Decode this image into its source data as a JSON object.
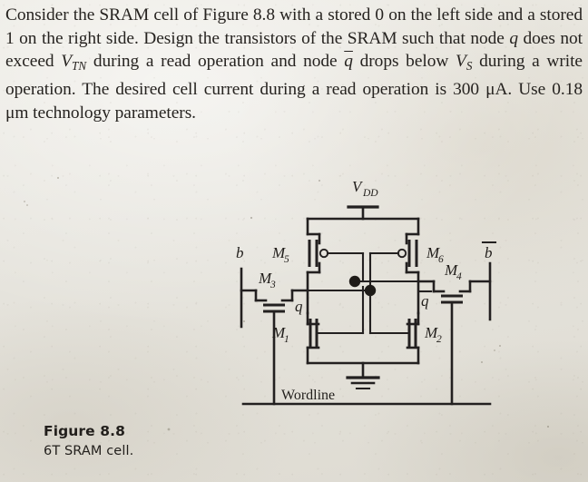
{
  "page": {
    "background_color": "#e6e4de",
    "ink_color": "#232020"
  },
  "statement": {
    "line1_a": "Consider the SRAM cell of Figure 8.8 with a stored 0 on the left side and a stored 1 on the right side. Design the transistors of the SRAM such that node ",
    "q_italic": "q",
    "line1_b": " does not exceed ",
    "v_tn": "V",
    "v_tn_sub": "TN",
    "line1_c": " during a read operation and node ",
    "qbar_italic": "q",
    "line1_d": " drops below ",
    "v_s": "V",
    "v_s_sub": "S",
    "line1_e": " during a write operation. The desired cell current during a read operation is 300 μA. Use 0.18 μm technology parameters."
  },
  "caption": {
    "title": "Figure 8.8",
    "subtitle": "6T SRAM cell."
  },
  "circuit": {
    "type": "6T SRAM cell schematic",
    "supply_label": "V",
    "supply_sublabel": "DD",
    "ground_label": "",
    "wordline_label": "Wordline",
    "bitline_left_label": "b",
    "bitline_right_label": "b",
    "node_left_label": "q",
    "node_right_label": "q",
    "transistors": [
      {
        "name": "M",
        "index": "1",
        "type": "nmos",
        "role": "left pull-down"
      },
      {
        "name": "M",
        "index": "2",
        "type": "nmos",
        "role": "right pull-down"
      },
      {
        "name": "M",
        "index": "3",
        "type": "nmos",
        "role": "left access"
      },
      {
        "name": "M",
        "index": "4",
        "type": "nmos",
        "role": "right access"
      },
      {
        "name": "M",
        "index": "5",
        "type": "pmos",
        "role": "left pull-up"
      },
      {
        "name": "M",
        "index": "6",
        "type": "pmos",
        "role": "right pull-up"
      }
    ]
  }
}
